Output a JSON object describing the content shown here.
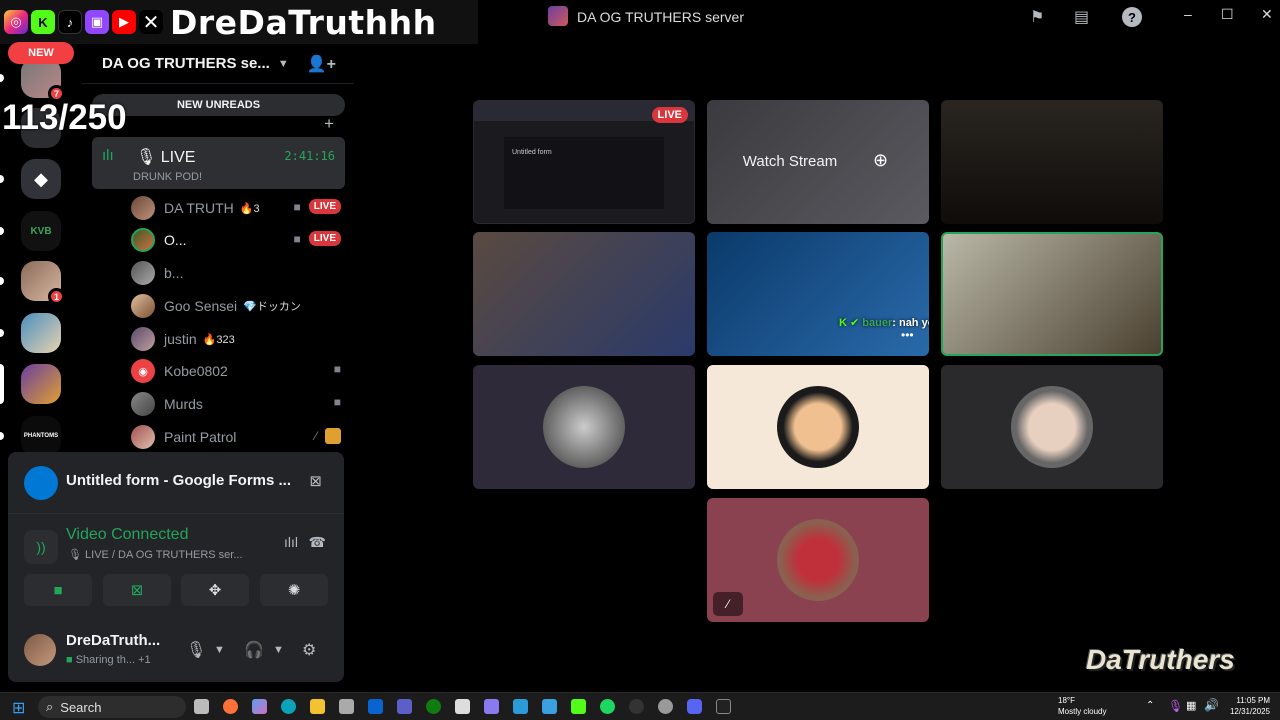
{
  "overlay": {
    "streamer_name": "DreDaTruthhh",
    "member_count": "113/250",
    "watermark": "DaTruthers",
    "social_icons": [
      "instagram-icon",
      "kick-icon",
      "tiktok-icon",
      "twitch-icon",
      "youtube-icon",
      "x-icon"
    ]
  },
  "window": {
    "title": "DA OG TRUTHERS server",
    "controls": [
      "–",
      "☐",
      "✕"
    ]
  },
  "server_rail": {
    "new_label": "NEW",
    "items": [
      {
        "name": "server-1",
        "badge": "7"
      },
      {
        "name": "server-2",
        "label": "",
        "badge": ""
      },
      {
        "name": "server-3",
        "label": "",
        "badge": ""
      },
      {
        "name": "server-kvb",
        "label": "KVB",
        "badge": ""
      },
      {
        "name": "server-5",
        "label": "",
        "badge": "1"
      },
      {
        "name": "server-6",
        "label": "",
        "badge": ""
      },
      {
        "name": "server-7",
        "label": "",
        "badge": ""
      },
      {
        "name": "server-phantoms",
        "label": "PHANTOMS",
        "badge": ""
      }
    ]
  },
  "sidebar": {
    "server_name": "DA OG TRUTHERS se...",
    "new_unreads": "NEW UNREADS",
    "voice_channel": {
      "name": "LIVE",
      "timer": "2:41:16",
      "status": "DRUNK POD!"
    },
    "members": [
      {
        "name": "DA TRUTH",
        "extra": "🔥3",
        "cam": true,
        "live": "LIVE"
      },
      {
        "name": "O...",
        "extra": "",
        "cam": true,
        "live": "LIVE"
      },
      {
        "name": "b...",
        "extra": "",
        "cam": false,
        "live": ""
      },
      {
        "name": "Goo Sensei",
        "extra": "💎ドッカン",
        "cam": false,
        "live": ""
      },
      {
        "name": "justin",
        "extra": "🔥323",
        "cam": false,
        "live": ""
      },
      {
        "name": "Kobe0802",
        "extra": "",
        "cam": true,
        "live": ""
      },
      {
        "name": "Murds",
        "extra": "",
        "cam": true,
        "live": ""
      },
      {
        "name": "Paint Patrol",
        "extra": "",
        "cam": false,
        "live": ""
      }
    ]
  },
  "panel": {
    "share_title": "Untitled form - Google Forms ...",
    "voice_title": "Video Connected",
    "voice_sub": "🎙 LIVE / DA OG TRUTHERS ser...",
    "username": "DreDaTruth...",
    "user_sub": "Sharing th...",
    "user_sub_extra": "+1"
  },
  "stage": {
    "live_label": "LIVE",
    "watch_label": "Watch Stream",
    "form_title": "Untitled form",
    "chat_user": "bauer",
    "chat_text": ": nah you soft now",
    "more": "•••"
  },
  "taskbar": {
    "search_placeholder": "Search",
    "temp": "18°F",
    "weather": "Mostly cloudy",
    "time": "11:05 PM",
    "date": "12/31/2025"
  },
  "colors": {
    "live_red": "#da373c",
    "voice_green": "#23a55a",
    "badge_red": "#f23f42"
  }
}
